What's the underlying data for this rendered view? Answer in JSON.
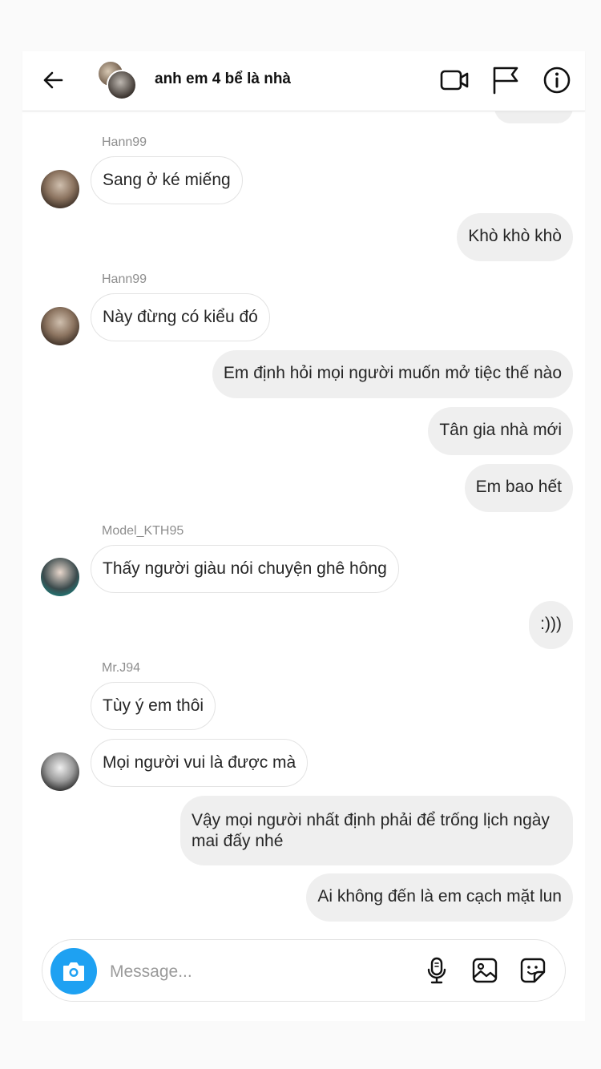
{
  "header": {
    "title": "anh em 4 bể là nhà",
    "icons": [
      "back-arrow-icon",
      "video-call-icon",
      "flag-icon",
      "info-icon"
    ]
  },
  "messages": [
    {
      "sender": "Hann99",
      "text": "Sang ở ké miếng",
      "direction": "in"
    },
    {
      "text": "Khò khò khò",
      "direction": "out"
    },
    {
      "sender": "Hann99",
      "text": "Này đừng có kiểu đó",
      "direction": "in"
    },
    {
      "text": "Em định hỏi mọi người muốn mở tiệc thế nào",
      "direction": "out"
    },
    {
      "text": "Tân gia nhà mới",
      "direction": "out"
    },
    {
      "text": "Em bao hết",
      "direction": "out"
    },
    {
      "sender": "Model_KTH95",
      "text": "Thấy người giàu nói chuyện ghê hông",
      "direction": "in"
    },
    {
      "text": ":)))",
      "direction": "out"
    },
    {
      "sender": "Mr.J94",
      "text": "Tùy ý em thôi",
      "direction": "in"
    },
    {
      "text": "Mọi người vui là được mà",
      "direction": "in"
    },
    {
      "text": "Vậy mọi người nhất định phải để trống lịch ngày mai đấy nhé",
      "direction": "out"
    },
    {
      "text": "Ai không đến là em cạch mặt lun",
      "direction": "out"
    }
  ],
  "composer": {
    "placeholder": "Message...",
    "icons": [
      "camera-icon",
      "microphone-icon",
      "image-icon",
      "sticker-icon"
    ]
  },
  "colors": {
    "accent": "#1ea1f2",
    "outgoing_bubble": "#efefef",
    "incoming_bubble": "#ffffff",
    "sender_label": "#8e8e8e"
  }
}
